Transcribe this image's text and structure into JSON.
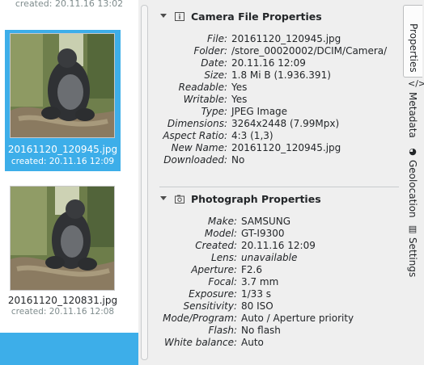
{
  "thumbnails": {
    "top_partial_created": "created: 20.11.16 13:02",
    "items": [
      {
        "filename": "20161120_120945.jpg",
        "created": "created: 20.11.16 12:09",
        "selected": true
      },
      {
        "filename": "20161120_120831.jpg",
        "created": "created: 20.11.16 12:08",
        "selected": false
      }
    ]
  },
  "camera_file_properties": {
    "title": "Camera File Properties",
    "rows": [
      {
        "key": "File:",
        "value": "20161120_120945.jpg"
      },
      {
        "key": "Folder:",
        "value": "/store_00020002/DCIM/Camera/"
      },
      {
        "key": "Date:",
        "value": "20.11.16 12:09"
      },
      {
        "key": "Size:",
        "value": "1.8 Mi B (1.936.391)"
      },
      {
        "key": "Readable:",
        "value": "Yes"
      },
      {
        "key": "Writable:",
        "value": "Yes"
      },
      {
        "key": "Type:",
        "value": "JPEG Image"
      },
      {
        "key": "Dimensions:",
        "value": "3264x2448 (7.99Mpx)"
      },
      {
        "key": "Aspect Ratio:",
        "value": "4:3 (1,3)"
      },
      {
        "key": "New Name:",
        "value": "20161120_120945.jpg"
      },
      {
        "key": "Downloaded:",
        "value": "No"
      }
    ]
  },
  "photograph_properties": {
    "title": "Photograph Properties",
    "rows": [
      {
        "key": "Make:",
        "value": "SAMSUNG"
      },
      {
        "key": "Model:",
        "value": "GT-I9300"
      },
      {
        "key": "Created:",
        "value": "20.11.16 12:09"
      },
      {
        "key": "Lens:",
        "value": "unavailable",
        "italic": true
      },
      {
        "key": "Aperture:",
        "value": "F2.6"
      },
      {
        "key": "Focal:",
        "value": "3.7 mm"
      },
      {
        "key": "Exposure:",
        "value": "1/33 s"
      },
      {
        "key": "Sensitivity:",
        "value": "80 ISO"
      },
      {
        "key": "Mode/Program:",
        "value": "Auto / Aperture priority"
      },
      {
        "key": "Flash:",
        "value": "No flash"
      },
      {
        "key": "White balance:",
        "value": "Auto"
      }
    ]
  },
  "side_tabs": [
    {
      "label": "Properties",
      "icon": "info-icon",
      "active": true
    },
    {
      "label": "Metadata",
      "icon": "code-icon",
      "active": false
    },
    {
      "label": "Geolocation",
      "icon": "globe-icon",
      "active": false
    },
    {
      "label": "Settings",
      "icon": "settings-icon",
      "active": false
    }
  ],
  "colors": {
    "selection": "#3daee9",
    "panel_bg": "#efefef",
    "text": "#232629",
    "subtext": "#7f8c8d"
  }
}
